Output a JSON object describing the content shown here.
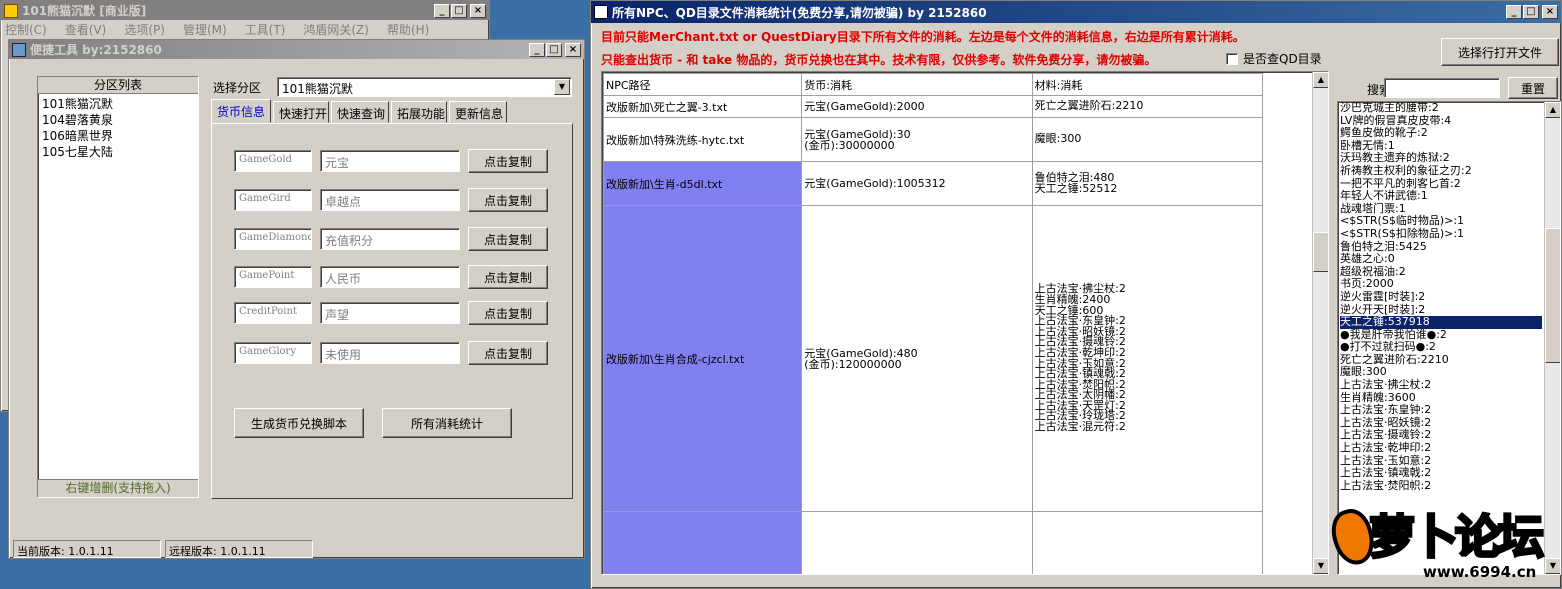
{
  "main_window": {
    "title": "101熊猫沉默 [商业版]",
    "menu": [
      "控制(C)",
      "查看(V)",
      "选项(P)",
      "管理(M)",
      "工具(T)",
      "鸿盾网关(Z)",
      "帮助(H)"
    ],
    "status_current": "当前版本: 1.0.1.11",
    "status_remote": "远程版本: 1.0.1.11"
  },
  "tool_window": {
    "title": "便捷工具  by:2152860",
    "zone_list_header": "分区列表",
    "zones": [
      "101熊猫沉默",
      "104碧落黄泉",
      "106暗黑世界",
      "105七星大陆"
    ],
    "zone_list_footer": "右键增删(支持拖入)",
    "select_zone_label": "选择分区",
    "select_zone_value": "101熊猫沉默",
    "tabs": [
      "货币信息",
      "快速打开",
      "快速查询",
      "拓展功能",
      "更新信息"
    ],
    "currency_rows": [
      {
        "key": "GameGold",
        "name": "元宝",
        "button": "点击复制"
      },
      {
        "key": "GameGird",
        "name": "卓越点",
        "button": "点击复制"
      },
      {
        "key": "GameDiamond",
        "name": "充值积分",
        "button": "点击复制"
      },
      {
        "key": "GamePoint",
        "name": "人民币",
        "button": "点击复制"
      },
      {
        "key": "CreditPoint",
        "name": "声望",
        "button": "点击复制"
      },
      {
        "key": "GameGlory",
        "name": "未使用",
        "button": "点击复制"
      }
    ],
    "gen_script_button": "生成货币兑换脚本",
    "all_stats_button": "所有消耗统计"
  },
  "stats_window": {
    "title": "所有NPC、QD目录文件消耗统计(免费分享,请勿被骗)      by 2152860",
    "notice1": "目前只能MerChant.txt or QuestDiary目录下所有文件的消耗。左边是每个文件的消耗信息，右边是所有累计消耗。",
    "notice2": "只能查出货币 - 和 take 物品的，货币兑换也在其中。技术有限，仅供参考。软件免费分享，请勿被骗。",
    "qd_checkbox_label": "是否查QD目录",
    "open_file_button": "选择行打开文件",
    "search_label": "搜索",
    "reset_button": "重置",
    "columns": [
      "NPC路径",
      "货币:消耗",
      "材料:消耗"
    ],
    "rows": [
      {
        "path": "改版新加\\死亡之翼-3.txt",
        "currency": [
          "元宝(GameGold):2000"
        ],
        "materials": [
          "死亡之翼进阶石:2210"
        ],
        "hl": false
      },
      {
        "path": "改版新加\\特殊洗练-hytc.txt",
        "currency": [
          "元宝(GameGold):30",
          "(金币):30000000"
        ],
        "materials": [
          "魔眼:300"
        ],
        "hl": false
      },
      {
        "path": "改版新加\\生肖-d5dl.txt",
        "currency": [
          "元宝(GameGold):1005312"
        ],
        "materials": [
          "鲁伯特之泪:480",
          "天工之锤:52512"
        ],
        "hl": true
      },
      {
        "path": "改版新加\\生肖合成-cjzcl.txt",
        "currency": [
          "元宝(GameGold):480",
          "(金币):120000000"
        ],
        "materials": [
          "上古法宝·拂尘杖:2",
          "生肖精魄:2400",
          "天工之锤:600",
          "上古法宝·东皇钟:2",
          "上古法宝·昭妖镜:2",
          "上古法宝·摄魂铃:2",
          "上古法宝·乾坤印:2",
          "上古法宝·玉如意:2",
          "上古法宝·镇魂戟:2",
          "上古法宝·焚阳帜:2",
          "上古法宝·太阴幡:2",
          "上古法宝·天罡灯:2",
          "上古法宝·玲珑塔:2",
          "上古法宝·混元符:2"
        ],
        "hl": true
      },
      {
        "path": "",
        "currency": [],
        "materials": [],
        "hl": true
      }
    ],
    "totals": [
      "沙巴克城主的腰带:2",
      "LV牌的假冒真皮皮带:4",
      "鳄鱼皮做的靴子:2",
      "卧槽无情:1",
      "沃玛教主遗弃的炼狱:2",
      "祈祷教主权利的象征之刃:2",
      "一把不平凡的刺客匕首:2",
      "年轻人不讲武德:1",
      "战魂塔门票:1",
      "<$STR(S$临时物品)>:1",
      "<$STR(S$扣除物品)>:1",
      "鲁伯特之泪:5425",
      "英雄之心:0",
      "超级祝福油:2",
      "书页:2000",
      "逆火雷霆[时装]:2",
      "逆火开天[时装]:2",
      "天工之锤:537918",
      "●我是肝帝我怕谁●:2",
      "●打不过就扫码●:2",
      "死亡之翼进阶石:2210",
      "魔眼:300",
      "上古法宝·拂尘杖:2",
      "生肖精魄:3600",
      "上古法宝·东皇钟:2",
      "上古法宝·昭妖镜:2",
      "上古法宝·摄魂铃:2",
      "上古法宝·乾坤印:2",
      "上古法宝·玉如意:2",
      "上古法宝·镇魂戟:2",
      "上古法宝·焚阳帜:2"
    ],
    "selected_total_index": 17
  },
  "watermark": {
    "text": "萝卜论坛",
    "url": "www.6994.cn"
  },
  "colors": {
    "highlight_cell": "#8080f0",
    "notice_red": "#e00000",
    "selection": "#0a246a",
    "watermark_orange": "#f07800"
  }
}
